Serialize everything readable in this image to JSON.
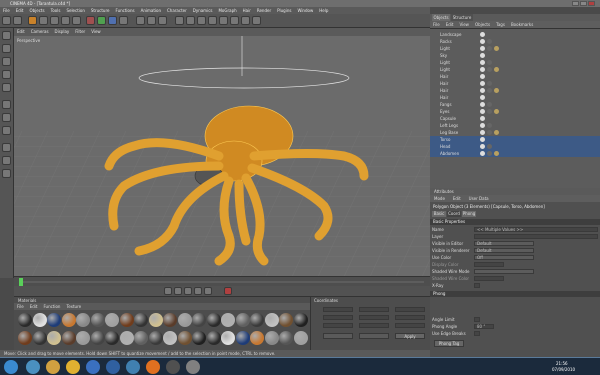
{
  "window": {
    "title": "CINEMA 4D - [Tarantula.c4d *]"
  },
  "menubar": [
    "File",
    "Edit",
    "Objects",
    "Tools",
    "Selection",
    "Structure",
    "Functions",
    "Animation",
    "Character",
    "Dynamics",
    "MoGraph",
    "Hair",
    "Render",
    "Plugins",
    "Window",
    "Help"
  ],
  "viewport": {
    "menu": [
      "Edit",
      "Cameras",
      "Display",
      "Filter",
      "View"
    ],
    "label": "Perspective"
  },
  "objects": {
    "tabs": [
      "Objects",
      "Structure"
    ],
    "menu": [
      "File",
      "Edit",
      "View",
      "Objects",
      "Tags",
      "Bookmarks"
    ],
    "items": [
      {
        "name": "Landscape"
      },
      {
        "name": "Rocks"
      },
      {
        "name": "Light"
      },
      {
        "name": "Sky"
      },
      {
        "name": "Light"
      },
      {
        "name": "Light"
      },
      {
        "name": "Hair"
      },
      {
        "name": "Hair"
      },
      {
        "name": "Hair"
      },
      {
        "name": "Hair"
      },
      {
        "name": "Fangs"
      },
      {
        "name": "Eyes"
      },
      {
        "name": "Capsule"
      },
      {
        "name": "Left Legs"
      },
      {
        "name": "Leg Base"
      },
      {
        "name": "Torso"
      },
      {
        "name": "Head"
      },
      {
        "name": "Abdomen"
      }
    ]
  },
  "attributes": {
    "header": "Attributes",
    "menu": [
      "Mode",
      "Edit",
      "User Data"
    ],
    "object_title": "Polygon Object (3 Elements) [Capsule, Torso, Abdomen]",
    "tabs": [
      "Basic",
      "Coord",
      "Phong"
    ],
    "basic_section": "Basic Properties",
    "rows": [
      {
        "label": "Name",
        "value": "<< Multiple Values >>"
      },
      {
        "label": "Layer",
        "value": ""
      },
      {
        "label": "Visible in Editor",
        "value": "Default"
      },
      {
        "label": "Visible in Renderer",
        "value": "Default"
      },
      {
        "label": "Use Color",
        "value": "Off"
      },
      {
        "label": "Display Color",
        "value": ""
      },
      {
        "label": "Shaded Wire Mode",
        "value": ""
      },
      {
        "label": "Shaded Wire Color",
        "value": ""
      },
      {
        "label": "X-Ray",
        "value": ""
      }
    ],
    "phong_section": "Phong",
    "phong_rows": [
      {
        "label": "Angle Limit",
        "value": ""
      },
      {
        "label": "Phong Angle",
        "value": "80 °"
      },
      {
        "label": "Use Edge Breaks",
        "value": ""
      }
    ],
    "phong_button": "Phong Tag"
  },
  "materials": {
    "header": "Materials",
    "menu": [
      "File",
      "Edit",
      "Function",
      "Texture"
    ]
  },
  "coordinates": {
    "header": "Coordinates",
    "apply": "Apply"
  },
  "statusbar": {
    "text": "Move: Click and drag to move elements. Hold down SHIFT to quantize movement / add to the selection in point mode, CTRL to remove."
  },
  "taskbar": {
    "time": "21:56",
    "date": "07/09/2010"
  }
}
